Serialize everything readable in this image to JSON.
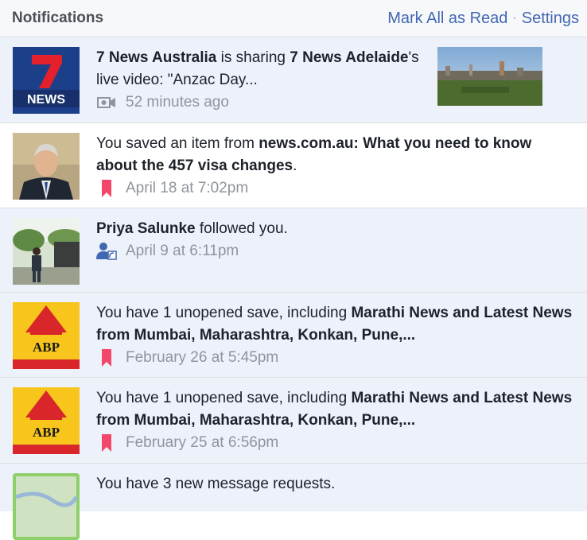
{
  "header": {
    "title": "Notifications",
    "mark_all_label": "Mark All as Read",
    "separator": "·",
    "settings_label": "Settings"
  },
  "notifications": [
    {
      "actor": "7 News Australia",
      "text_1": " is sharing ",
      "target": "7 News Adelaide",
      "text_2": "'s live video: \"Anzac Day...",
      "time": "52 minutes ago",
      "meta_icon": "video-camera-icon",
      "thumb_label": "NEWS",
      "unread": true
    },
    {
      "text_1": "You saved an item from ",
      "source": "news.com.au",
      "title": ": What you need to know about the 457 visa changes",
      "text_2": ".",
      "time": "April 18 at 7:02pm",
      "meta_icon": "bookmark-icon",
      "unread": false
    },
    {
      "actor": "Priya Salunke",
      "text_1": " followed you.",
      "time": "April 9 at 6:11pm",
      "meta_icon": "follow-icon",
      "unread": true
    },
    {
      "text_1": "You have 1 unopened save, including ",
      "title": "Marathi News and Latest News from Mumbai, Maharashtra, Konkan, Pune,...",
      "time": "February 26 at 5:45pm",
      "meta_icon": "bookmark-icon",
      "thumb_label": "ABP",
      "unread": true
    },
    {
      "text_1": "You have 1 unopened save, including ",
      "title": "Marathi News and Latest News from Mumbai, Maharashtra, Konkan, Pune,...",
      "time": "February 25 at 6:56pm",
      "meta_icon": "bookmark-icon",
      "thumb_label": "ABP",
      "unread": true
    },
    {
      "text_1": "You have 3 new message requests.",
      "unread": true
    }
  ],
  "colors": {
    "link": "#4267b2",
    "unread_bg": "#edf2fa",
    "meta_text": "#90949c",
    "bookmark": "#f2476a",
    "news_blue": "#1c3f8a",
    "abp_yellow": "#f7c51c",
    "abp_red": "#d9262b"
  }
}
